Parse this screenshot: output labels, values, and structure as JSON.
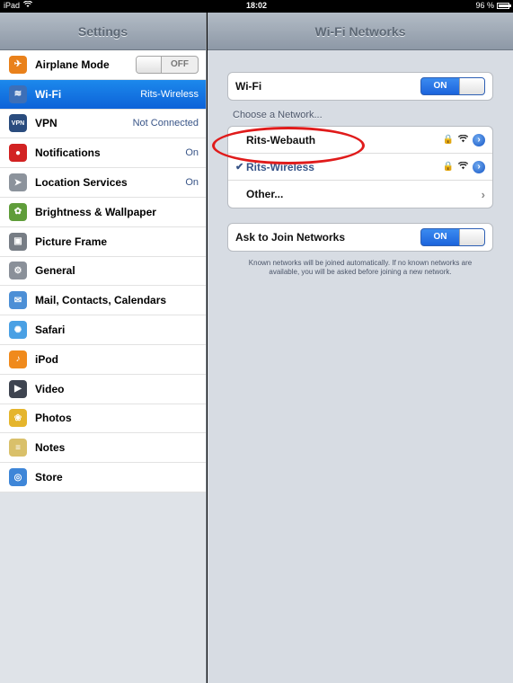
{
  "status_bar": {
    "device": "iPad",
    "time": "18:02",
    "battery": "96 %",
    "battery_level": 0.96
  },
  "sidebar": {
    "title": "Settings",
    "items": [
      {
        "label": "Airplane Mode",
        "value": "",
        "toggle": "OFF",
        "icon": "airplane-icon",
        "color": "#e9811b"
      },
      {
        "label": "Wi-Fi",
        "value": "Rits-Wireless",
        "icon": "wifi-icon",
        "color": "#3d6fb7",
        "selected": true
      },
      {
        "label": "VPN",
        "value": "Not Connected",
        "icon": "vpn-icon",
        "color": "#2a4c7e"
      },
      {
        "label": "Notifications",
        "value": "On",
        "icon": "notifications-icon",
        "color": "#d22222"
      },
      {
        "label": "Location Services",
        "value": "On",
        "icon": "location-icon",
        "color": "#8c939c"
      },
      {
        "label": "Brightness & Wallpaper",
        "value": "",
        "icon": "brightness-icon",
        "color": "#5f9d3a"
      },
      {
        "label": "Picture Frame",
        "value": "",
        "icon": "picture-frame-icon",
        "color": "#777d85"
      },
      {
        "label": "General",
        "value": "",
        "icon": "gear-icon",
        "color": "#8a9099"
      },
      {
        "label": "Mail, Contacts, Calendars",
        "value": "",
        "icon": "mail-icon",
        "color": "#4c8fd6"
      },
      {
        "label": "Safari",
        "value": "",
        "icon": "safari-icon",
        "color": "#4aa0e4"
      },
      {
        "label": "iPod",
        "value": "",
        "icon": "ipod-icon",
        "color": "#f08a1c"
      },
      {
        "label": "Video",
        "value": "",
        "icon": "video-icon",
        "color": "#3e4450"
      },
      {
        "label": "Photos",
        "value": "",
        "icon": "photos-icon",
        "color": "#e5b52c"
      },
      {
        "label": "Notes",
        "value": "",
        "icon": "notes-icon",
        "color": "#d9c06a"
      },
      {
        "label": "Store",
        "value": "",
        "icon": "store-icon",
        "color": "#3e86d8"
      }
    ]
  },
  "main": {
    "title": "Wi-Fi Networks",
    "wifi_label": "Wi-Fi",
    "wifi_toggle": "ON",
    "choose_title": "Choose a Network...",
    "networks": [
      {
        "name": "Rits-Webauth",
        "locked": true,
        "checked": false
      },
      {
        "name": "Rits-Wireless",
        "locked": true,
        "checked": true
      }
    ],
    "other_label": "Other...",
    "ask_label": "Ask to Join Networks",
    "ask_toggle": "ON",
    "footnote": "Known networks will be joined automatically.  If no known networks are available, you will be asked before joining a new network."
  },
  "colors": {
    "selected": "#0d62d8",
    "annotation": "#e01b1b"
  }
}
